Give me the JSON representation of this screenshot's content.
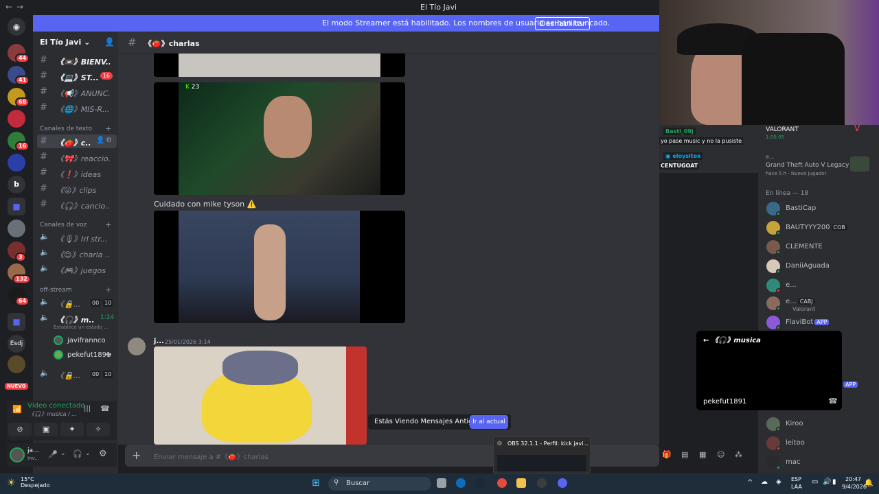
{
  "titlebar": {
    "title": "El Tío Javi"
  },
  "banner": {
    "text": "El modo Streamer está habilitado. Los nombres de usuario se han truncado.",
    "button": "Deshabilitar"
  },
  "rail": {
    "badges": [
      "44",
      "41",
      "68",
      "16",
      "3",
      "132",
      "64"
    ],
    "labels": [
      "b",
      "Esdj"
    ],
    "new_label": "NUEVO"
  },
  "sidebar": {
    "guild_name": "El Tío Javi",
    "top_channels": [
      {
        "label": "《📼》BIENV..."
      },
      {
        "label": "《💻》ST...",
        "mentions": "16"
      },
      {
        "label": "《📢》ANUNC..."
      },
      {
        "label": "《🌐》MIS-R..."
      }
    ],
    "text_category": "Canales de texto",
    "text_channels": [
      {
        "label": "《🍅》c..."
      },
      {
        "label": "《🎀》reaccio..."
      },
      {
        "label": "《❗》ideas"
      },
      {
        "label": "《😜》clips"
      },
      {
        "label": "《🎧》cancio..."
      }
    ],
    "voice_category": "Canales de voz",
    "voice_channels": [
      {
        "label": "《🎙》Irl str..."
      },
      {
        "label": "《😊》charla ..."
      },
      {
        "label": "《🎮》juegos"
      }
    ],
    "offstream_category": "off-stream",
    "offstream": [
      {
        "label": "《🔒...",
        "count_a": "00",
        "count_b": "10"
      },
      {
        "label": "《🎧》m...",
        "time": "1:24",
        "status": "Establece un estado ..."
      },
      {
        "label": "《🔒...",
        "count_a": "00",
        "count_b": "10"
      }
    ],
    "voice_users": [
      "javifrannco",
      "pekefut1891"
    ]
  },
  "voicepanel": {
    "status": "Vídeo conectado",
    "channel": "《🎧》musica / ..."
  },
  "userpanel": {
    "name": "ja...",
    "sub": "Inv..."
  },
  "chat": {
    "channel": "《🍅》charlas",
    "messages": [
      {
        "text": "Cuidado con mike tyson ⚠️"
      },
      {
        "author": "j...",
        "timestamp": "25/01/2026 3:14"
      }
    ],
    "video_badge": "23",
    "old_messages": "Estás Viendo Mensajes Antiguos",
    "jump_button": "Ir al actual",
    "composer_placeholder": "Enviar mensaje a #《🍅》charlas"
  },
  "stream_overlay": {
    "chat1_user": "Basti_09j",
    "chat1_msg": "yo pase music y no la pusiste",
    "chat2_user": "eloysitox",
    "chat2_msg": "CENTUGOAT",
    "activity1_title": "VALORANT",
    "activity1_time": "1:00:05",
    "activity2_user": "e...",
    "activity2_title": "Grand Theft Auto V Legacy",
    "activity2_sub": "hace 5 h · Nuevo jugador"
  },
  "members": {
    "online_header": "En línea — 18",
    "list": [
      {
        "name": "BastiCap"
      },
      {
        "name": "BAUTYYY200",
        "tag": "COB"
      },
      {
        "name": "CLEMENTE"
      },
      {
        "name": "DaniiAguada"
      },
      {
        "name": "e..."
      },
      {
        "name": "e...",
        "tag": "CABJ",
        "sub": "Valorant"
      },
      {
        "name": "FlaviBot",
        "tag": "APP"
      },
      {
        "name": "Kiroo"
      },
      {
        "name": "leitoo"
      },
      {
        "name": "mac"
      }
    ],
    "hidden_tag": "APP"
  },
  "popout": {
    "title": "《🎧》musica",
    "user": "pekefut1891"
  },
  "obs": {
    "title": "OBS 32.1.1 - Perfil: kick javi..."
  },
  "taskbar": {
    "temp": "15°C",
    "weather": "Despejado",
    "search": "Buscar",
    "lang1": "ESP",
    "lang2": "LAA",
    "time": "20:47",
    "date": "9/4/2026"
  },
  "colors": {
    "blurple": "#5865f2",
    "online": "#23a55a",
    "danger": "#f23f43"
  }
}
